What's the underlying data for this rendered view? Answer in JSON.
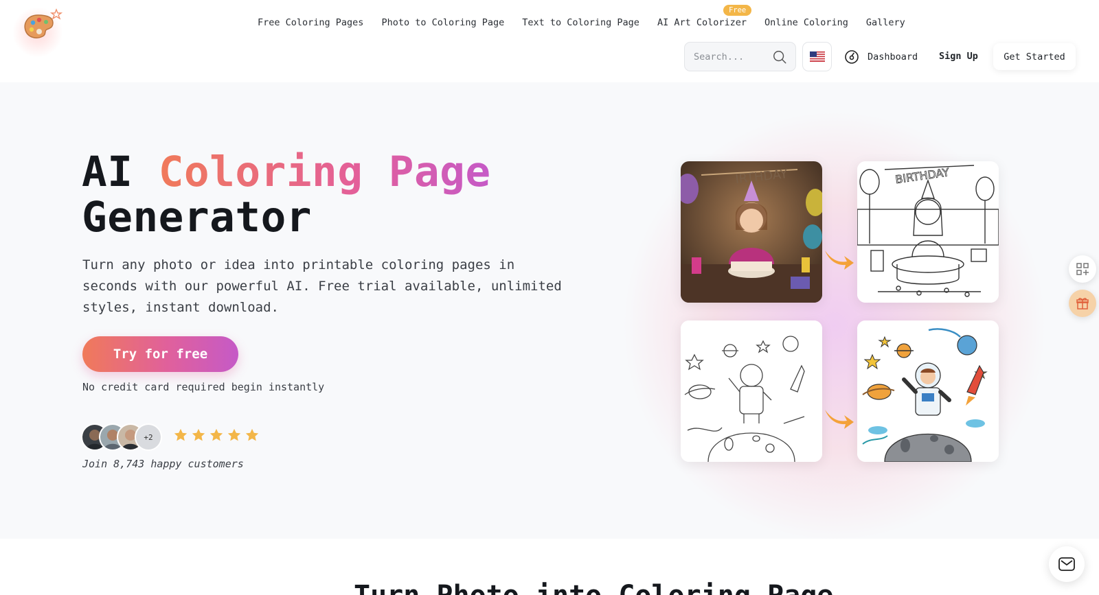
{
  "header": {
    "logo_icon": "palette-icon",
    "nav": [
      {
        "label": "Free Coloring Pages"
      },
      {
        "label": "Photo to Coloring Page"
      },
      {
        "label": "Text to Coloring Page"
      },
      {
        "label": "AI Art Colorizer",
        "badge": "Free"
      },
      {
        "label": "Online Coloring"
      },
      {
        "label": "Gallery"
      }
    ],
    "search_placeholder": "Search...",
    "language_icon": "us-flag-icon",
    "dashboard_label": "Dashboard",
    "signup_label": "Sign Up",
    "get_started_label": "Get Started"
  },
  "hero": {
    "title_plain_1": "AI ",
    "title_gradient": "Coloring Page",
    "title_plain_2": "Generator",
    "subtitle": "Turn any photo or idea into printable coloring pages in seconds with our powerful AI. Free trial available, unlimited styles, instant download.",
    "cta_label": "Try for free",
    "cta_note": "No credit card required begin instantly",
    "avatars_more": "+2",
    "rating": 5,
    "joined_text": "Join 8,743 happy customers"
  },
  "next_section": {
    "title": "Turn Photo into Coloring Page"
  },
  "colors": {
    "gradient_start": "#f07a5a",
    "gradient_mid": "#e0609c",
    "gradient_end": "#c55ac7",
    "star": "#f3b648",
    "badge": "#f3b648",
    "arrow": "#f4a23a"
  }
}
